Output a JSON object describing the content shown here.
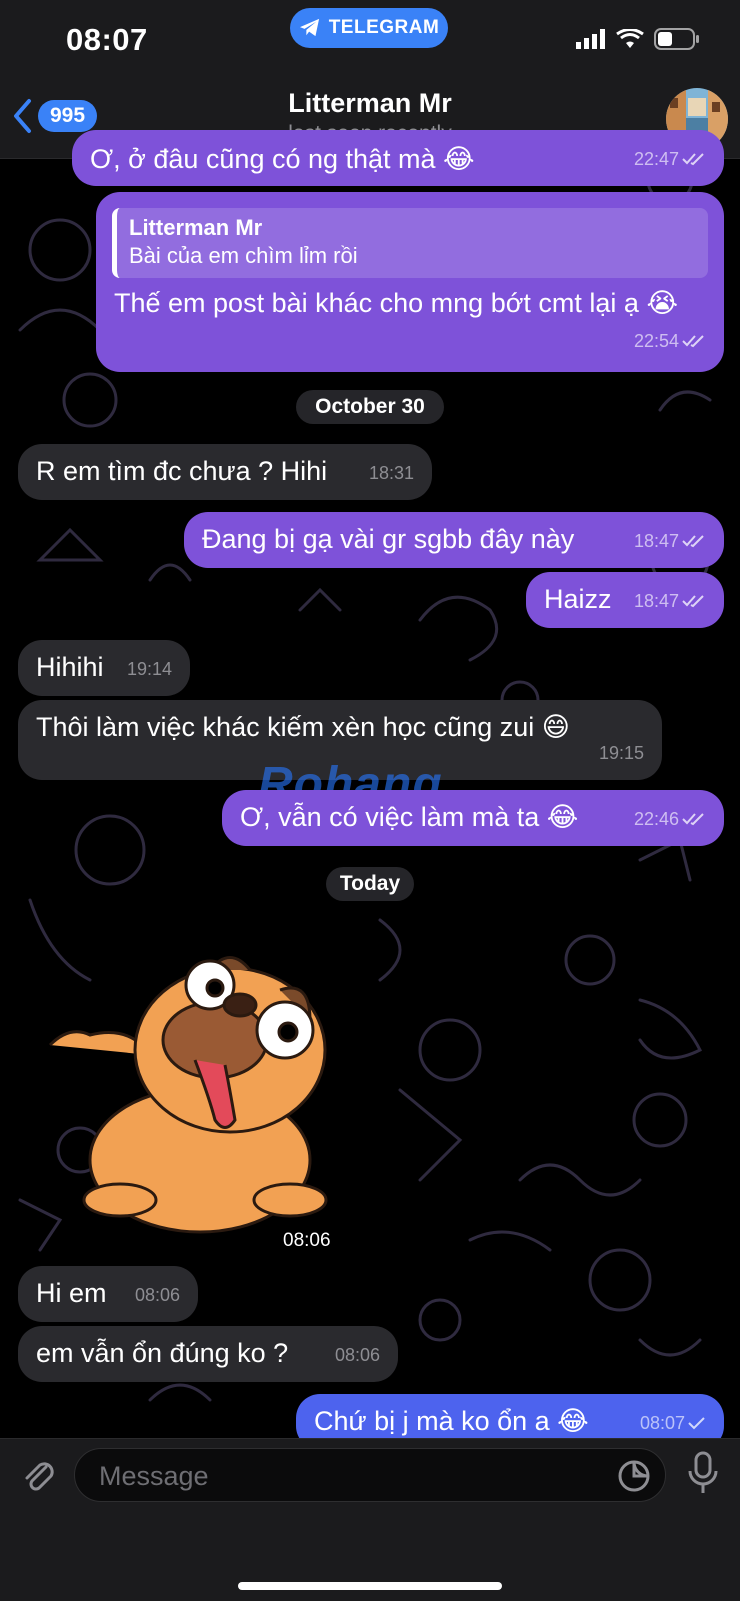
{
  "status_bar": {
    "time": "08:07",
    "app_pill": "TELEGRAM"
  },
  "header": {
    "back_count": "995",
    "title": "Litterman Mr",
    "subtitle": "last seen recently"
  },
  "messages": {
    "m0": {
      "text": "Ơ, ở đâu cũng có ng thật mà 😂",
      "time": "22:47"
    },
    "m1": {
      "reply_name": "Litterman Mr",
      "reply_text": "Bài của em chìm lỉm rồi",
      "text": "Thế em post bài khác cho mng bớt cmt lại ạ 😭",
      "time": "22:54"
    },
    "date1": "October 30",
    "m2": {
      "text": "R em tìm đc chưa ? Hihi",
      "time": "18:31"
    },
    "m3": {
      "text": "Đang bị gạ vài gr sgbb đây này",
      "time": "18:47"
    },
    "m4": {
      "text": "Haizz",
      "time": "18:47"
    },
    "m5": {
      "text": "Hihihi",
      "time": "19:14"
    },
    "m6": {
      "text": "Thôi làm việc khác kiếm xèn học cũng zui 😄",
      "time": "19:15"
    },
    "m7": {
      "text": "Ơ, vẫn có việc làm mà ta 😂",
      "time": "22:46"
    },
    "date2": "Today",
    "sticker": {
      "name": "pug-sticker",
      "time": "08:06"
    },
    "m8": {
      "text": "Hi em",
      "time": "08:06"
    },
    "m9": {
      "text": "em vẫn ổn đúng ko ?",
      "time": "08:06"
    },
    "m10": {
      "text": "Chứ bị j mà ko ổn a 😂",
      "time": "08:07"
    }
  },
  "watermark": {
    "part1": "Ro",
    "part2": "hang"
  },
  "input": {
    "placeholder": "Message"
  },
  "icons": [
    "telegram-icon",
    "signal-icon",
    "wifi-icon",
    "battery-icon",
    "back-chevron-icon",
    "attach-icon",
    "sticker-icon",
    "mic-icon",
    "double-check-icon",
    "single-check-icon"
  ],
  "colors": {
    "outgoing_bubble": "#7e52d9",
    "latest_outgoing_bubble": "#4d63ee",
    "incoming_bubble": "#2a2a2e",
    "accent": "#3a82f7",
    "background": "#000000"
  }
}
